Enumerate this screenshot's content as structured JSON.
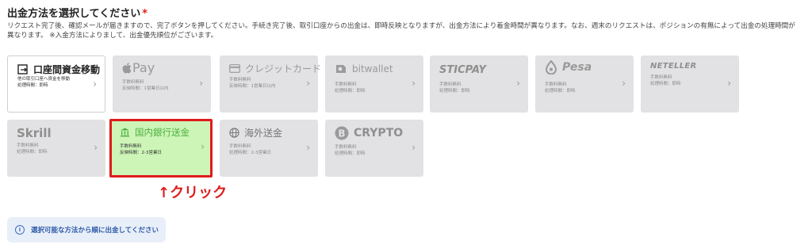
{
  "header": {
    "title": "出金方法を選択してください",
    "required_mark": "*",
    "description": [
      "リクエスト完了後、確認メールが届きますので、完了ボタンを押してください。手続き完了後、取引口座からの出金は、即時反映となりますが、出金方法により着金時間が異なります。なお、週末のリクエストは、ポジションの有無によって出金の処理時間が",
      "異なります。 ※入金方法によりまして、出金優先順位がございます。"
    ]
  },
  "methods": [
    {
      "name": "口座間資金移動",
      "icon": "transfer-icon",
      "lines": [
        "他の取引口座へ資金を移動",
        "処理時間：即時"
      ]
    },
    {
      "name": "Pay",
      "icon": "apple-icon",
      "lines": [
        "手数料無料",
        "反映時間：1営業日以内"
      ]
    },
    {
      "name": "クレジットカード",
      "icon": "credit-card-icon",
      "lines": [
        "手数料無料",
        "反映時間：1営業日以内"
      ]
    },
    {
      "name": "bitwallet",
      "icon": "bitwallet-icon",
      "lines": [
        "手数料無料",
        "処理時間：即時"
      ]
    },
    {
      "name": "STICPAY",
      "icon": "sticpay-logo",
      "lines": [
        "手数料無料",
        "処理時間：即時"
      ]
    },
    {
      "name": "Pesa",
      "icon": "pesa-icon",
      "lines": [
        "手数料無料",
        "処理時間：即時"
      ]
    },
    {
      "name": "NETELLER",
      "icon": "neteller-logo",
      "lines": [
        "手数料無料",
        "処理時間：即時"
      ]
    },
    {
      "name": "Skrill",
      "icon": "skrill-logo",
      "lines": [
        "手数料無料",
        "処理時間：即時"
      ]
    },
    {
      "name": "国内銀行送金",
      "icon": "bank-icon",
      "lines": [
        "手数料無料",
        "反映時間：2-3営業日"
      ]
    },
    {
      "name": "海外送金",
      "icon": "globe-icon",
      "lines": [
        "手数料無料",
        "処理時間：2-3営業日"
      ]
    },
    {
      "name": "CRYPTO",
      "icon": "bitcoin-icon",
      "lines": [
        "手数料無料",
        "処理時間：即時"
      ]
    }
  ],
  "annotation": "↑クリック",
  "notice": {
    "icon": "info-icon",
    "text": "選択可能な方法から順に出金してください"
  },
  "colors": {
    "selected_bg": "#cdf5b7",
    "selected_border": "#e01b1b",
    "annotation": "#e01b1b",
    "card_bg": "#e2e2e4"
  }
}
